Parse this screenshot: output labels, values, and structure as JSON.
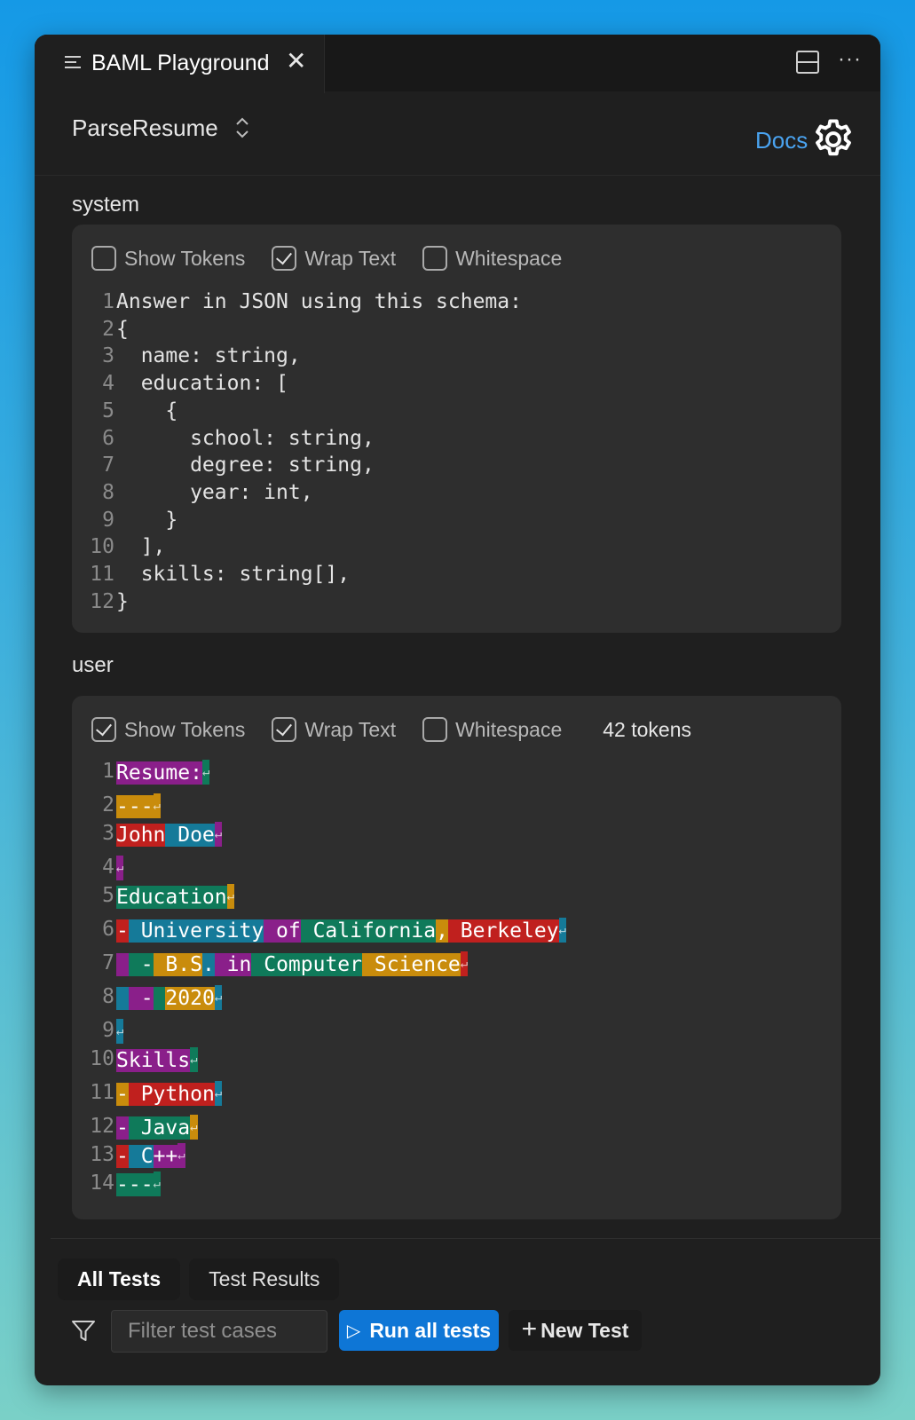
{
  "tab": {
    "title": "BAML Playground",
    "close_glyph": "✕",
    "more_glyph": "···"
  },
  "header": {
    "function_name": "ParseResume",
    "docs_label": "Docs"
  },
  "system": {
    "label": "system",
    "options": [
      {
        "label": "Show Tokens",
        "checked": false
      },
      {
        "label": "Wrap Text",
        "checked": true
      },
      {
        "label": "Whitespace",
        "checked": false
      }
    ],
    "lines": [
      "Answer in JSON using this schema:",
      "{",
      "  name: string,",
      "  education: [",
      "    {",
      "      school: string,",
      "      degree: string,",
      "      year: int,",
      "    }",
      "  ],",
      "  skills: string[],",
      "}"
    ]
  },
  "user": {
    "label": "user",
    "options": [
      {
        "label": "Show Tokens",
        "checked": true
      },
      {
        "label": "Wrap Text",
        "checked": true
      },
      {
        "label": "Whitespace",
        "checked": false
      }
    ],
    "token_count": "42 tokens",
    "newline_glyph": "↵",
    "lines": [
      [
        [
          "Resume:",
          "c1"
        ],
        [
          "↵",
          "c2"
        ]
      ],
      [
        [
          "---",
          "c3"
        ],
        [
          "↵",
          "c3"
        ]
      ],
      [
        [
          "John",
          "c4"
        ],
        [
          " Doe",
          "c5"
        ],
        [
          "↵",
          "c1"
        ]
      ],
      [
        [
          "↵",
          "c1"
        ]
      ],
      [
        [
          "Education",
          "c2"
        ],
        [
          "↵",
          "c3"
        ]
      ],
      [
        [
          "-",
          "c4"
        ],
        [
          " University",
          "c5"
        ],
        [
          " of",
          "c1"
        ],
        [
          " California",
          "c2"
        ],
        [
          ",",
          "c3"
        ],
        [
          " Berkeley",
          "c4"
        ],
        [
          "↵",
          "c5"
        ]
      ],
      [
        [
          " ",
          "c1"
        ],
        [
          " -",
          "c2"
        ],
        [
          " B",
          "c3"
        ],
        [
          ".S",
          "c3"
        ],
        [
          ".",
          "c5"
        ],
        [
          " in",
          "c1"
        ],
        [
          " Computer",
          "c2"
        ],
        [
          " Science",
          "c3"
        ],
        [
          "↵",
          "c4"
        ]
      ],
      [
        [
          " ",
          "c5"
        ],
        [
          " -",
          "c1"
        ],
        [
          " ",
          "c2"
        ],
        [
          "2020",
          "c3"
        ],
        [
          "↵",
          "c5"
        ]
      ],
      [
        [
          "↵",
          "c5"
        ]
      ],
      [
        [
          "Skills",
          "c1"
        ],
        [
          "↵",
          "c2"
        ]
      ],
      [
        [
          "-",
          "c3"
        ],
        [
          " Python",
          "c4"
        ],
        [
          "↵",
          "c5"
        ]
      ],
      [
        [
          "-",
          "c1"
        ],
        [
          " Java",
          "c2"
        ],
        [
          "↵",
          "c3"
        ]
      ],
      [
        [
          "-",
          "c4"
        ],
        [
          " C",
          "c5"
        ],
        [
          "++",
          "c1"
        ],
        [
          "↵",
          "c1"
        ]
      ],
      [
        [
          "---",
          "c2"
        ],
        [
          "↵",
          "c2"
        ]
      ]
    ]
  },
  "bottom": {
    "tabs": [
      "All Tests",
      "Test Results"
    ],
    "filter_placeholder": "Filter test cases",
    "run_all_label": "Run all tests",
    "new_test_label": "New Test",
    "run_icon": "▷",
    "new_icon": "+"
  },
  "colors": {
    "background_top": "#1599e6",
    "background_bottom": "#7ad0c7",
    "window": "#1f1f1f",
    "panel": "#2e2e2e",
    "accent": "#0e76d6",
    "link": "#4aa3f0",
    "token_purple": "#8a1f8a",
    "token_green": "#0f7a5a",
    "token_orange": "#c98c0c",
    "token_red": "#c0201e",
    "token_teal": "#157a99"
  }
}
